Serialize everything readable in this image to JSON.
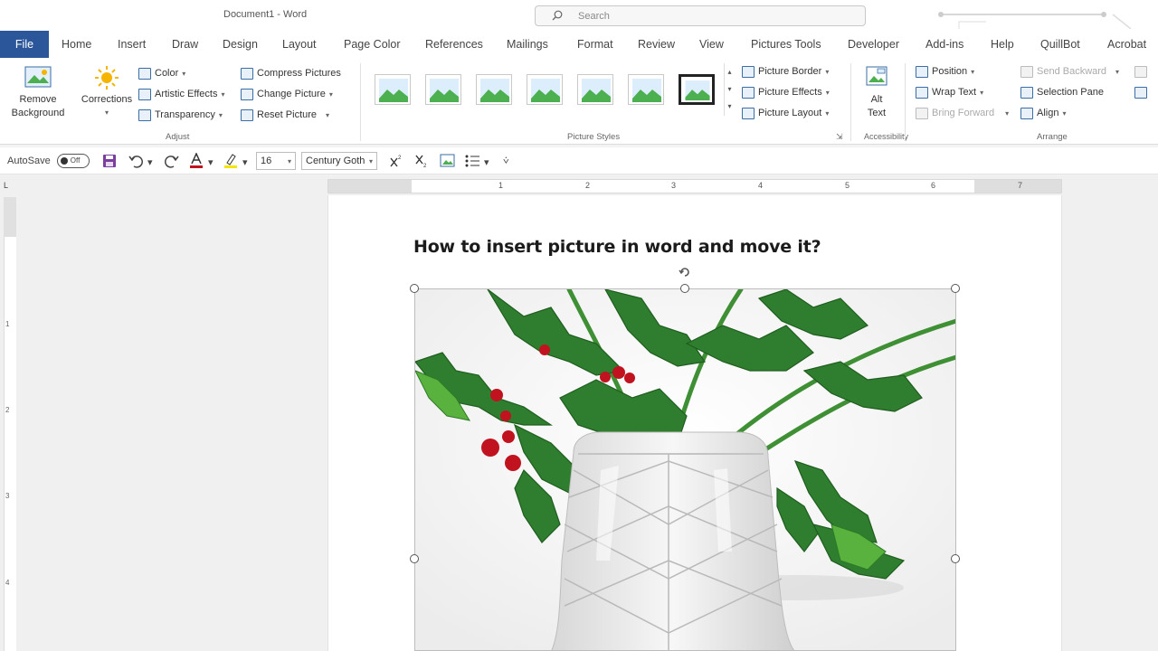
{
  "titlebar": {
    "doc_title": "Document1  -  Word",
    "search_placeholder": "Search"
  },
  "tabs": [
    "File",
    "Home",
    "Insert",
    "Draw",
    "Design",
    "Layout",
    "Page Color",
    "References",
    "Mailings",
    "Format",
    "Review",
    "View",
    "Pictures Tools",
    "Developer",
    "Add-ins",
    "Help",
    "QuillBot",
    "Acrobat"
  ],
  "ribbon": {
    "adjust": {
      "remove_background": [
        "Remove",
        "Background"
      ],
      "corrections": "Corrections",
      "color": "Color",
      "artistic_effects": "Artistic Effects",
      "transparency": "Transparency",
      "compress_pictures": "Compress Pictures",
      "change_picture": "Change Picture",
      "reset_picture": "Reset Picture",
      "label": "Adjust"
    },
    "picture_styles": {
      "label": "Picture Styles",
      "picture_border": "Picture Border",
      "picture_effects": "Picture Effects",
      "picture_layout": "Picture Layout"
    },
    "accessibility": {
      "alt_text": [
        "Alt",
        "Text"
      ],
      "label": "Accessibility"
    },
    "arrange": {
      "position": "Position",
      "wrap_text": "Wrap Text",
      "bring_forward": "Bring Forward",
      "send_backward": "Send Backward",
      "selection_pane": "Selection Pane",
      "align": "Align",
      "label": "Arrange"
    }
  },
  "qat": {
    "autosave": "AutoSave",
    "autosave_state": "Off",
    "font_size": "16",
    "font_name": "Century Goth"
  },
  "rulers": {
    "h_numbers": [
      "1",
      "2",
      "3",
      "4",
      "5",
      "6",
      "7"
    ],
    "v_numbers": [
      "1",
      "2",
      "3",
      "4"
    ],
    "corner": "L"
  },
  "document": {
    "heading": "How to insert picture in word and move it?"
  },
  "colors": {
    "file_tab": "#2b579a",
    "holly_green": "#2f7d2f",
    "berry_red": "#c1121f"
  },
  "icons": [
    "search-icon",
    "save-icon",
    "undo-icon",
    "redo-icon",
    "font-color-icon",
    "highlight-icon",
    "superscript-icon",
    "subscript-icon",
    "bullets-icon"
  ]
}
